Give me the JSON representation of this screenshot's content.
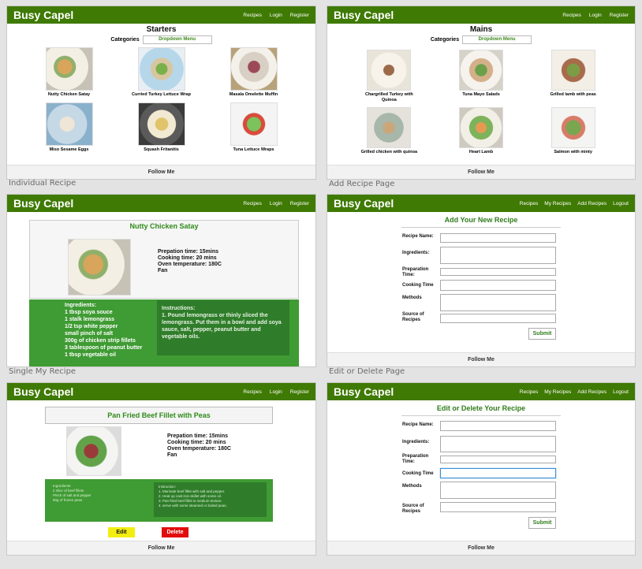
{
  "brand": "Busy Capel",
  "footer": "Follow Me",
  "nav_public": [
    "Recipes",
    "Login",
    "Register"
  ],
  "nav_user": [
    "Recipes",
    "My Recipes",
    "Add Recipes",
    "Logout"
  ],
  "captions": {
    "individual": "Individual Recipe",
    "add": "Add Recipe Page",
    "single": "Single My Recipe",
    "edit": "Edit or Delete Page"
  },
  "starters": {
    "title": "Starters",
    "categories_label": "Categories",
    "dropdown": "Dropdown Menu",
    "items": [
      "Nutty Chicken Satay",
      "Curried Turkey Lettuce Wrap",
      "Masala Omelette Muffin",
      "Miso Sesame Eggs",
      "Squash Fritanitis",
      "Tuna Lettuce Wraps"
    ]
  },
  "mains": {
    "title": "Mains",
    "categories_label": "Categories",
    "dropdown": "Dropdown Menu",
    "items": [
      "Chargrilled Turkey with Quinoa",
      "Tuna Mayo Salads",
      "Grilled lamb with peas",
      "Grilled chicken with quinoa",
      "Heart Lamb",
      "Salmon with minty"
    ]
  },
  "recipe": {
    "title": "Nutty Chicken Satay",
    "info": [
      "Prepation time: 15mins",
      "Cooking time: 20 mins",
      "Oven temperature: 180C",
      "Fan"
    ],
    "ingredients_label": "Ingredients:",
    "ingredients": [
      "1 tbsp soya souce",
      "1 stalk lemongrass",
      "1/2 tsp white pepper",
      "small pinch of salt",
      "300g of chicken strip fillets",
      "3 tablespoon of peanut butter",
      "1 tbsp vegetable oil"
    ],
    "instructions": "Instructions:\n1. Pound lemongrass or thinly sliced the lemongrass.  Put them in a bowl and add soya sauce, salt, pepper, peanut butter and vegetable oils."
  },
  "my_recipe": {
    "title": "Pan Fried Beef Fillet with Peas",
    "info": [
      "Prepation time: 15mins",
      "Cooking time: 20 mins",
      "Oven temperature: 180C",
      "Fan"
    ],
    "ingredients": "Ingredients:\n2 slice of beef fillets\nPinch of salt and pepper\n80g of frozen peas",
    "instructions": "Instruction:\n1. Marinate beef fillet with salt and pepper.\n2. Heat up cast iron skillet with some oil.\n3. Pan fried beef fillet to medium texture.\n4. serve with some steamed or boiled peas.",
    "edit_label": "Edit",
    "delete_label": "Delete"
  },
  "add_form": {
    "title": "Add Your New Recipe",
    "labels": [
      "Recipe Name:",
      "Ingredients:",
      "Preparation Time:",
      "Cooking Time",
      "Methods",
      "Source of Recipes"
    ],
    "submit": "Submit"
  },
  "edit_form": {
    "title": "Edit or Delete Your Recipe",
    "labels": [
      "Recipe Name:",
      "Ingredients:",
      "Preparation Time:",
      "Cooking Time",
      "Methods",
      "Source of Recipes"
    ],
    "submit": "Submit"
  },
  "colors": {
    "header": "#3f7a04",
    "band": "#3f9b33",
    "edit": "#f3ee12",
    "delete": "#e20c0c"
  }
}
